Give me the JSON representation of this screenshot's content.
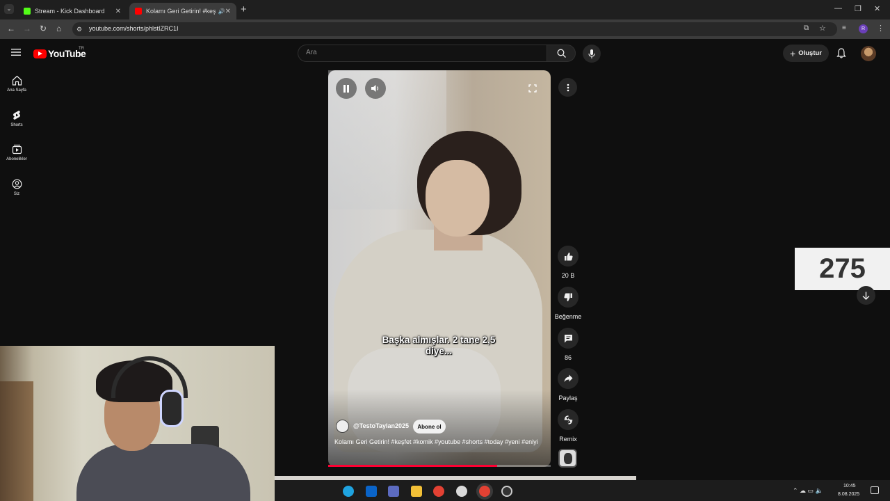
{
  "browser": {
    "tabs": [
      {
        "title": "Stream - Kick Dashboard",
        "favicon_color": "#53fc18",
        "active": false
      },
      {
        "title": "Kolamı Geri Getirin! #keşfe",
        "favicon_color": "#ff0000",
        "active": true
      }
    ],
    "url": "youtube.com/shorts/phlstIZRC1I",
    "profile_initial": "R"
  },
  "youtube": {
    "logo_text": "YouTube",
    "country_code": "TR",
    "search_placeholder": "Ara",
    "create_label": "Oluştur",
    "nav": [
      {
        "label": "Ana Sayfa",
        "icon": "home-icon"
      },
      {
        "label": "Shorts",
        "icon": "shorts-icon"
      },
      {
        "label": "Abonelikler",
        "icon": "subscriptions-icon"
      },
      {
        "label": "Siz",
        "icon": "you-icon"
      }
    ]
  },
  "short": {
    "caption": "Başka almışlar. 2 tane 2,5 diye...",
    "channel": "@TestoTaylan2025",
    "subscribe_label": "Abone ol",
    "title": "Kolamı Geri Getirin!  #keşfet #komik #youtube #shorts #today #yeni #eniyi",
    "progress_fraction": 0.76,
    "actions": {
      "like_count": "20 B",
      "dislike_label": "Beğenme",
      "comment_count": "86",
      "share_label": "Paylaş",
      "remix_label": "Remix"
    }
  },
  "overlay": {
    "counter_value": "275"
  },
  "taskbar": {
    "time": "10:45",
    "date": "8.08.2025",
    "apps": [
      {
        "name": "edge-icon",
        "color": "#1fa3e0"
      },
      {
        "name": "outlook-icon",
        "color": "#0a64c8"
      },
      {
        "name": "store-icon",
        "color": "#5c6bc0"
      },
      {
        "name": "explorer-icon",
        "color": "#f2c037"
      },
      {
        "name": "chrome-icon",
        "color": "#e34133"
      },
      {
        "name": "chatgpt-icon",
        "color": "#d9d9d9"
      },
      {
        "name": "chrome-profile-icon",
        "color": "#e34133"
      },
      {
        "name": "obs-icon",
        "color": "#cccccc"
      }
    ]
  }
}
